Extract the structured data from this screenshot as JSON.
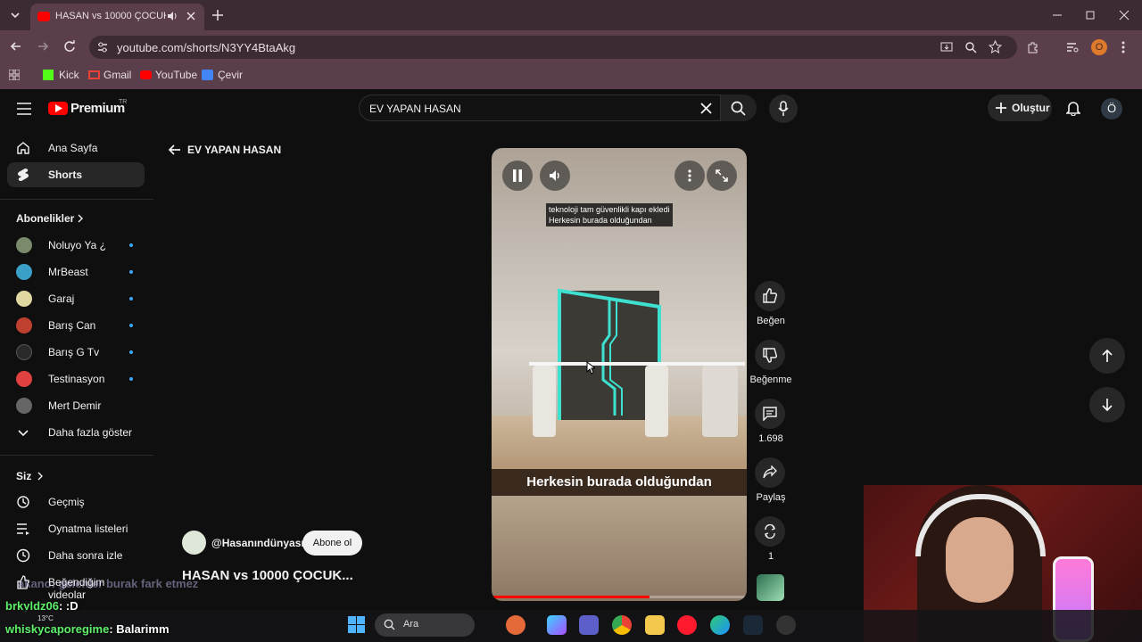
{
  "browser": {
    "tab_title": "HASAN vs 10000 ÇOCUK...",
    "url": "youtube.com/shorts/N3YY4BtaAkg",
    "bookmarks": [
      "Kick",
      "Gmail",
      "YouTube",
      "Çevir"
    ],
    "profile_initial": "O"
  },
  "header": {
    "logo": "Premium",
    "logo_sup": "TR",
    "search_value": "EV YAPAN HASAN",
    "create_label": "Oluştur",
    "account_initial": "Ö"
  },
  "sidebar": {
    "top": [
      {
        "label": "Ana Sayfa"
      },
      {
        "label": "Shorts"
      }
    ],
    "subs_heading": "Abonelikler",
    "subs": [
      {
        "label": "Noluyo Ya ¿",
        "color": "#7a8a6b"
      },
      {
        "label": "MrBeast",
        "color": "#3aa0c8"
      },
      {
        "label": "Garaj",
        "color": "#e0d8a0"
      },
      {
        "label": "Barış Can",
        "color": "#c04030"
      },
      {
        "label": "Barış G Tv",
        "color": "#2a2a2a"
      },
      {
        "label": "Testinasyon",
        "color": "#e04040"
      },
      {
        "label": "Mert Demir",
        "color": "#666"
      }
    ],
    "more_label": "Daha fazla göster",
    "you_heading": "Siz",
    "you_items": [
      {
        "label": "Geçmiş"
      },
      {
        "label": "Oynatma listeleri"
      },
      {
        "label": "Daha sonra izle"
      },
      {
        "label": "Beğendiğim videolar"
      }
    ]
  },
  "main": {
    "back_label": "EV YAPAN HASAN",
    "caption_top_line1": "teknoloji tam güvenlikli kapı ekledi",
    "caption_top_line2": "Herkesin burada olduğundan",
    "subtitle": "Herkesin burada olduğundan",
    "channel": "@Hasanındünyası",
    "subscribe_label": "Abone ol",
    "video_title": "HASAN vs 10000 ÇOCUK...",
    "progress": 0.62
  },
  "actions": {
    "like_label": "Beğen",
    "dislike_label": "Beğenme",
    "comments_count": "1.698",
    "share_label": "Paylaş",
    "remix_count": "1"
  },
  "overlay": {
    "chat": [
      {
        "user": "brkyldz06",
        "text": ": :D"
      },
      {
        "user": "whiskycaporegime",
        "text": ": Balarimm"
      }
    ],
    "faded_chat": "akano: gelenler burak fark etmez",
    "weather": "13°C",
    "taskbar_search": "Ara"
  },
  "colors": {
    "yt_red": "#ff0000",
    "chrome_dark": "#3c2b33",
    "chrome_mid": "#5a3e4b",
    "link_blue": "#3ea6ff"
  }
}
